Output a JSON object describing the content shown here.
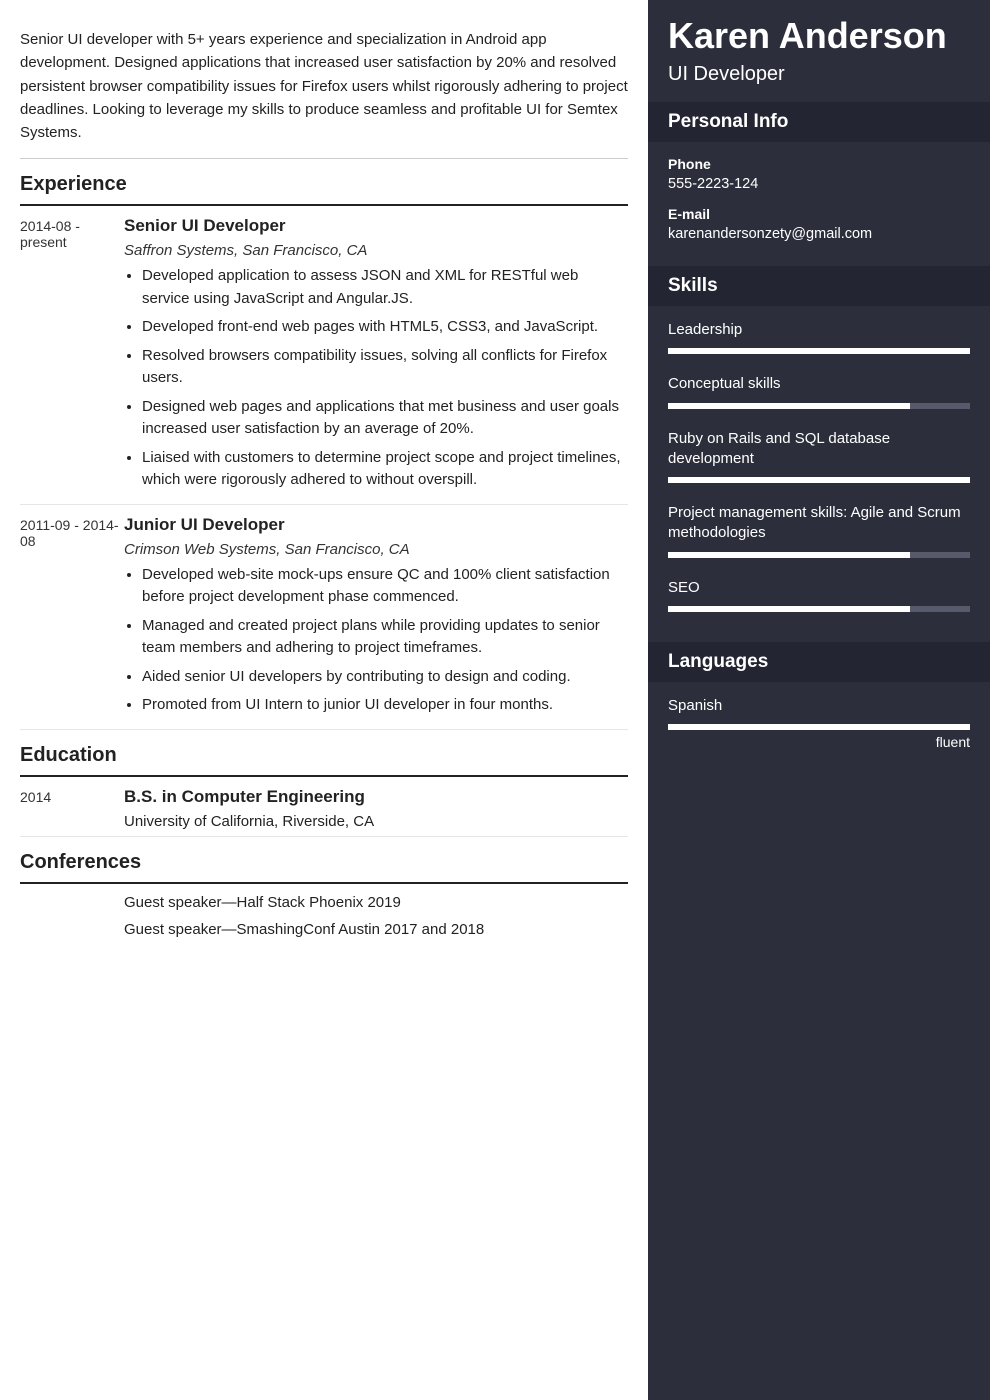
{
  "name": "Karen Anderson",
  "title": "UI Developer",
  "summary": "Senior UI developer with 5+ years experience and specialization in Android app development. Designed applications that increased user satisfaction by 20% and resolved persistent browser compatibility issues for Firefox users whilst rigorously adhering to project deadlines. Looking to leverage my skills to produce seamless and profitable UI for Semtex Systems.",
  "sections": {
    "experience": "Experience",
    "education": "Education",
    "conferences": "Conferences",
    "personal_info": "Personal Info",
    "skills": "Skills",
    "languages": "Languages"
  },
  "experience": [
    {
      "date": "2014-08 - present",
      "role": "Senior UI Developer",
      "company": "Saffron Systems, San Francisco, CA",
      "bullets": [
        "Developed application to assess JSON and XML for RESTful web service using JavaScript and Angular.JS.",
        "Developed front-end web pages with HTML5, CSS3, and JavaScript.",
        "Resolved browsers compatibility issues, solving all conflicts for Firefox users.",
        "Designed web pages and applications that met business and user goals increased user satisfaction by an average of 20%.",
        "Liaised with customers to determine project scope and project timelines, which were rigorously adhered to without overspill."
      ]
    },
    {
      "date": "2011-09 - 2014-08",
      "role": "Junior UI Developer",
      "company": "Crimson Web Systems, San Francisco, CA",
      "bullets": [
        "Developed web-site mock-ups ensure QC and 100% client satisfaction before project development phase commenced.",
        "Managed and created project plans while providing updates to senior team members and adhering to project timeframes.",
        "Aided senior UI developers by contributing to design and coding.",
        "Promoted from UI Intern to junior UI developer in four months."
      ]
    }
  ],
  "education": [
    {
      "date": "2014",
      "degree": "B.S. in Computer Engineering",
      "school": "University of California, Riverside, CA"
    }
  ],
  "conferences": [
    "Guest speaker—Half Stack Phoenix 2019",
    "Guest speaker—SmashingConf Austin 2017 and 2018"
  ],
  "personal": {
    "phone_label": "Phone",
    "phone": "555-2223-124",
    "email_label": "E-mail",
    "email": "karenandersonzety@gmail.com"
  },
  "skills": [
    {
      "name": "Leadership",
      "level": 100
    },
    {
      "name": "Conceptual skills",
      "level": 80
    },
    {
      "name": "Ruby on Rails and SQL database development",
      "level": 100
    },
    {
      "name": "Project management skills: Agile and Scrum methodologies",
      "level": 80
    },
    {
      "name": "SEO",
      "level": 80
    }
  ],
  "languages": [
    {
      "name": "Spanish",
      "level": 100,
      "label": "fluent"
    }
  ]
}
